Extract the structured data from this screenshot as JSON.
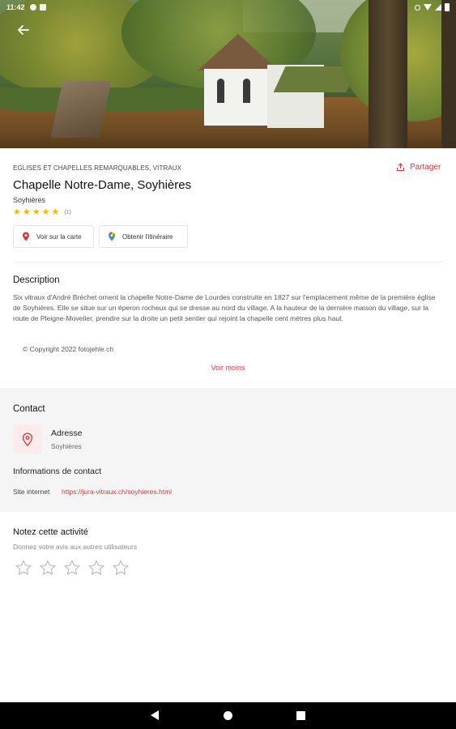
{
  "statusbar": {
    "time": "11:42"
  },
  "place": {
    "category": "EGLISES ET CHAPELLES REMARQUABLES, VITRAUX",
    "share_label": "Partager",
    "title": "Chapelle Notre-Dame, Soyhières",
    "location": "Soyhières",
    "rating": {
      "stars": 5,
      "count": "(1)"
    }
  },
  "actions": {
    "map_label": "Voir sur la carte",
    "directions_label": "Obtenir l'itinéraire"
  },
  "description": {
    "heading": "Description",
    "text": "Six vitraux d'André Bréchet ornent la chapelle Notre-Dame de Lourdes construite en 1827 sur l'emplacement même de la première église de Soyhières. Elle se situe sur un éperon rocheux qui se dresse au nord du village. A la hauteur de la dernière maison du village, sur la route de Pleigne-Movelier, prendre sur la droite un petit sentier qui rejoint la chapelle cent mètres plus haut.",
    "copyright": "© Copyright 2022 fotojehle.ch",
    "toggle_label": "Voir moins"
  },
  "contact": {
    "heading": "Contact",
    "address_label": "Adresse",
    "address_value": "Soyhières",
    "info_heading": "Informations de contact",
    "website_label": "Site internet",
    "website_url": "https://jura-vitraux.ch/soyhieres.html"
  },
  "rate": {
    "heading": "Notez cette activité",
    "subtitle": "Donnez votre avis aux autres utilisateurs"
  },
  "colors": {
    "accent": "#d7363b",
    "star": "#f2b600"
  }
}
